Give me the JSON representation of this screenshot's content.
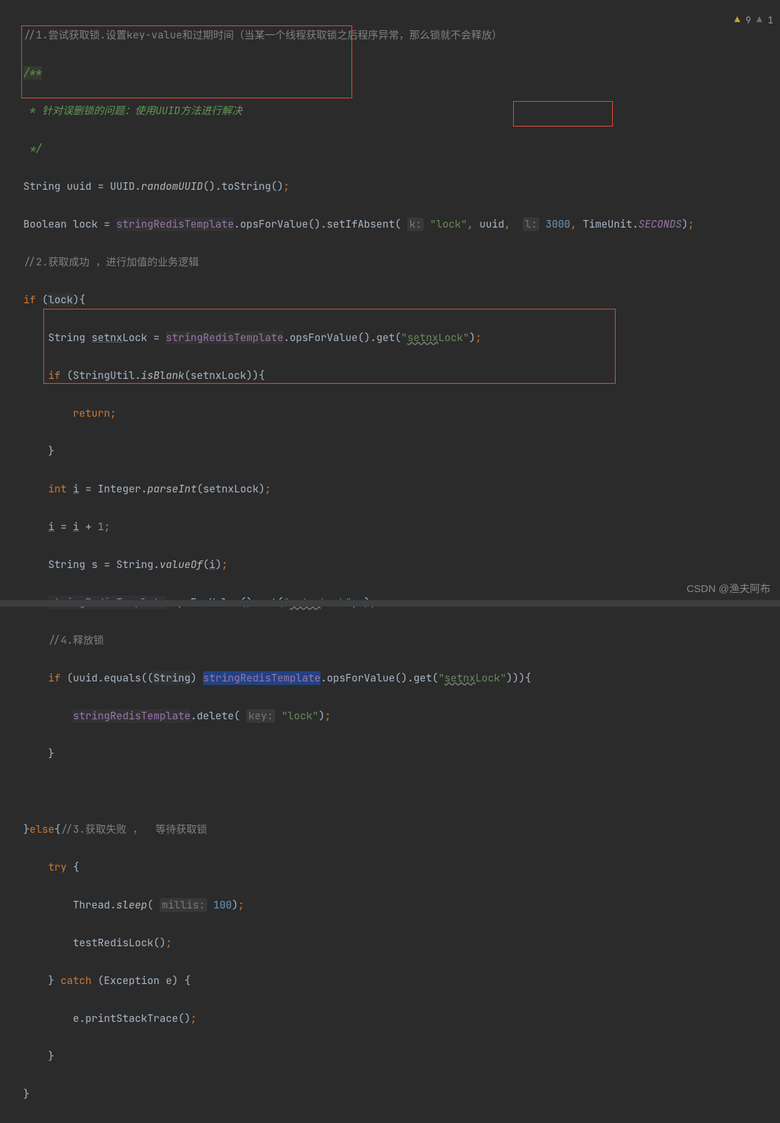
{
  "problems": {
    "warnings": "9",
    "weak_warnings": "1"
  },
  "watermark": "CSDN @渔夫阿布",
  "code": {
    "l1_a": "//1.尝试获取锁.设置key-value和过期时间（当某一个线程获取锁之后程序异常，那么锁就不会释放）",
    "l2_a": "/**",
    "l3_a": " * 针对误删锁的问题：使用UUID方法进行解决",
    "l4_a": " */",
    "l5_a": "String uuid = UUID.",
    "l5_b": "randomUUID",
    "l5_c": "().toString()",
    "l5_d": ";",
    "l6_a": "Boolean lock = ",
    "l6_b": "stringRedisTemplate",
    "l6_c": ".opsForValue().setIfAbsent(",
    "l6_d": "k:",
    "l6_e": "\"lock\"",
    "l6_f": ",",
    "l6_g": " uuid",
    "l6_h": ",",
    "l6_i": "l:",
    "l6_j": "3000",
    "l6_k": ",",
    "l6_l": " TimeUnit.",
    "l6_m": "SECONDS",
    "l6_n": ")",
    "l6_o": ";",
    "l7_a": "//2.获取成功 ，进行加值的业务逻辑",
    "l8_a": "if",
    "l8_b": " (",
    "l8_c": "lock",
    "l8_d": "){",
    "l9_a": "    String ",
    "l9_b": "setnx",
    "l9_c": "Lock = ",
    "l9_d": "stringRedisTemplate",
    "l9_e": ".opsForValue().get(",
    "l9_f": "\"",
    "l9_g": "setnx",
    "l9_h": "Lock\"",
    "l9_i": ")",
    "l9_j": ";",
    "l10_a": "    if",
    "l10_b": " (StringUtil.",
    "l10_c": "isBlank",
    "l10_d": "(setnxLock)){",
    "l11_a": "        return",
    "l11_b": ";",
    "l12_a": "    }",
    "l13_a": "    int",
    "l13_b": " ",
    "l13_c": "i",
    "l13_d": " = Integer.",
    "l13_e": "parseInt",
    "l13_f": "(setnxLock)",
    "l13_g": ";",
    "l14_a": "    ",
    "l14_b": "i",
    "l14_c": " = ",
    "l14_d": "i",
    "l14_e": " + ",
    "l14_f": "1",
    "l14_g": ";",
    "l15_a": "    String s = String.",
    "l15_b": "valueOf",
    "l15_c": "(",
    "l15_d": "i",
    "l15_e": ")",
    "l15_f": ";",
    "l16_a": "    ",
    "l16_b": "stringRedisTemplate",
    "l16_c": ".opsForValue().set(",
    "l16_d": "\"",
    "l16_e": "setnx",
    "l16_f": "Lock\"",
    "l16_g": ",s)",
    "l16_h": ";",
    "l17_a": "    //4.释放锁",
    "l18_a": "    if",
    "l18_b": " (uuid.equals((",
    "l18_c": "String",
    "l18_d": ") ",
    "l18_e": "stringRedisTemplate",
    "l18_f": ".opsForValue().get(",
    "l18_g": "\"",
    "l18_h": "setnx",
    "l18_i": "Lock\"",
    "l18_j": "))){",
    "l19_a": "        ",
    "l19_b": "stringRedisTemplate",
    "l19_c": ".delete(",
    "l19_d": "key:",
    "l19_e": "\"lock\"",
    "l19_f": ")",
    "l19_g": ";",
    "l20_a": "    }",
    "l22_a": "}",
    "l22_b": "else",
    "l22_c": "{",
    "l22_d": "//3.获取失败 ，  等待获取锁",
    "l23_a": "    try",
    "l23_b": " {",
    "l24_a": "        Thread.",
    "l24_b": "sleep",
    "l24_c": "(",
    "l24_d": "millis:",
    "l24_e": "100",
    "l24_f": ")",
    "l24_g": ";",
    "l25_a": "        testRedisLock()",
    "l25_b": ";",
    "l26_a": "    } ",
    "l26_b": "catch",
    "l26_c": " (Exception e) {",
    "l27_a": "        e.printStackTrace()",
    "l27_b": ";",
    "l28_a": "    }",
    "l29_a": "}"
  }
}
